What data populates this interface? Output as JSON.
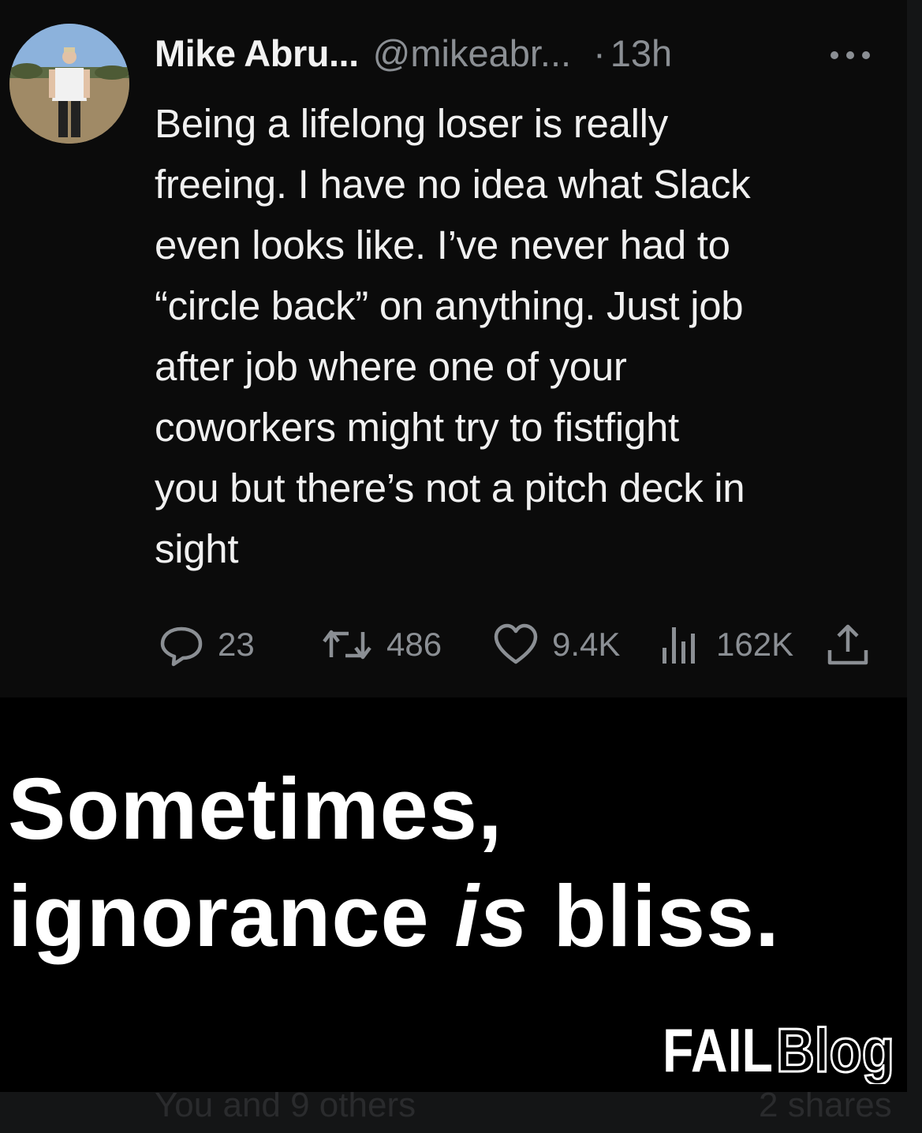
{
  "tweet": {
    "display_name": "Mike Abru...",
    "handle": "@mikeabr...",
    "separator": "·",
    "time": "13h",
    "body_lines": [
      "Being a lifelong loser is really",
      "freeing. I have no idea what Slack",
      "even looks like. I’ve never had to",
      "“circle back” on anything. Just job",
      "after job where one of your",
      "coworkers might try to fistfight",
      "you but there’s not a pitch deck in",
      "sight"
    ],
    "stats": {
      "replies": "23",
      "retweets": "486",
      "likes": "9.4K",
      "views": "162K"
    }
  },
  "caption": {
    "line1": "Sometimes,",
    "line2_before": "ignorance ",
    "line2_emphasis": "is",
    "line2_after": " bliss."
  },
  "logo": {
    "part1": "FAIL",
    "part2": "Blog"
  },
  "footer": {
    "reactions_text": "You and 9 others",
    "shares_text": "2 shares"
  },
  "colors": {
    "card_bg": "#0b0b0b",
    "caption_bg": "#000000",
    "text_primary": "#f0f0f0",
    "text_secondary": "#8b8f94"
  }
}
